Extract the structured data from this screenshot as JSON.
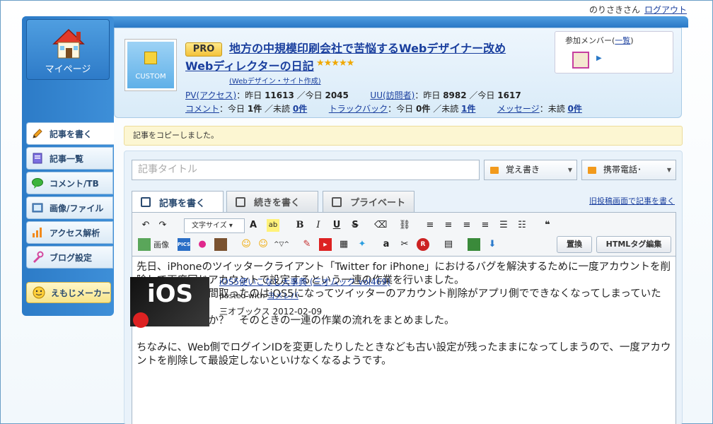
{
  "topbar": {
    "user": "のりさきさん",
    "logout": "ログアウト"
  },
  "mypage": {
    "label": "マイページ"
  },
  "sidenav": {
    "items": [
      {
        "label": "記事を書く",
        "icon": "pencil-icon"
      },
      {
        "label": "記事一覧",
        "icon": "document-icon"
      },
      {
        "label": "コメント/TB",
        "icon": "speech-bubble-icon"
      },
      {
        "label": "画像/ファイル",
        "icon": "image-icon"
      },
      {
        "label": "アクセス解析",
        "icon": "bar-chart-icon"
      },
      {
        "label": "ブログ設定",
        "icon": "wrench-icon"
      }
    ],
    "emoji_maker": "えもじメーカー"
  },
  "header": {
    "custom_label": "CUSTOM",
    "pro_badge": "PRO",
    "title_line1": "地方の中規模印刷会社で苦悩するWebデザイナー改め",
    "title_line2": "Webディレクターの日記",
    "stars": "★★★★★",
    "genre": "(Webデザイン・サイト作成)",
    "pv_label": "PV(アクセス)",
    "pv_text": "：昨日",
    "pv_yesterday": "11613",
    "pv_sep": "／今日",
    "pv_today": "2045",
    "uu_label": "UU(訪問者)",
    "uu_text": "：昨日",
    "uu_yesterday": "8982",
    "uu_sep": "／今日",
    "uu_today": "1617",
    "comment_label": "コメント",
    "comment_today_text": "：今日",
    "comment_today": "1件",
    "comment_unread_text": "／未読",
    "comment_unread": "0件",
    "trackback_label": "トラックバック",
    "trackback_today_text": "：今日",
    "trackback_today": "0件",
    "trackback_unread_text": "／未読",
    "trackback_unread": "1件",
    "message_label": "メッセージ",
    "message_unread_text": "：未読",
    "message_unread": "0件",
    "members_label": "参加メンバー",
    "members_link": "一覧",
    "members_open": "(",
    "members_close": ")"
  },
  "notice": "記事をコピーしました。",
  "editor": {
    "title_placeholder": "記事タイトル",
    "category1": "覚え書き",
    "category2": "携帯電話･",
    "tabs": [
      "記事を書く",
      "続きを書く",
      "プライベート"
    ],
    "old_link": "旧投稿画面で記事を書く",
    "font_size": "文字サイズ",
    "btn_image": "画像",
    "btn_pics": "PICS",
    "btn_replace": "置換",
    "btn_html": "HTMLタグ編集",
    "body_line1": "先日、iPhoneのツイッタークライアント「Twitter for iPhone」におけるバグを解決するために一度アカウントを削除して再度同じアカウントで設定するという一連の作業を行いました。",
    "body_line2": "その際、結構手間取ったのはiOS5になってツイッターのアカウント削除がアプリ側でできなくなってしまっていたため。",
    "body_line3": "ではどうするのか？　そのときの一連の作業の流れをまとめました。",
    "body_line4": "ちなみに、Web側でログインIDを変更したりしたときなども古い設定が残ったままになってしまうので、一度アカウントを削除して最設定しないといけなくなるようです。",
    "book_cover_text": "iOS",
    "book_title": "iOS5使いこなし大事典 (三才ムック vol469)",
    "posted_with": "posted with ",
    "posted_link": "ヨメレバ",
    "publisher": "三オブックス  2012-02-09"
  }
}
